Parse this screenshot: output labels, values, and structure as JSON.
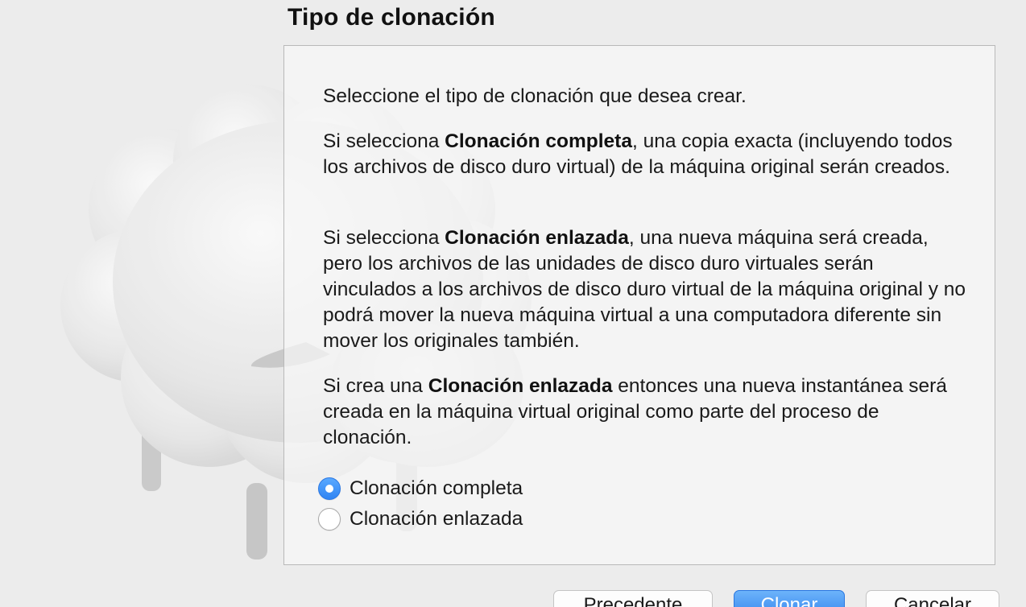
{
  "title": "Tipo de clonación",
  "intro": "Seleccione el tipo de clonación que desea crear.",
  "full_clone_para": {
    "prefix": "Si selecciona ",
    "bold": "Clonación completa",
    "suffix": ", una copia exacta (incluyendo todos los archivos de disco duro virtual) de la máquina original serán creados."
  },
  "linked_clone_para": {
    "prefix": "Si selecciona ",
    "bold": "Clonación enlazada",
    "suffix": ", una nueva máquina será creada, pero los archivos de las unidades de disco duro virtuales serán vinculados a los archivos de disco duro virtual de la máquina original y no podrá mover la nueva máquina virtual a una computadora diferente sin mover los originales también."
  },
  "snapshot_para": {
    "prefix": "Si crea una ",
    "bold": "Clonación enlazada",
    "suffix": " entonces una nueva instantánea será creada en la máquina virtual original como parte del proceso de clonación."
  },
  "options": [
    {
      "label": "Clonación completa",
      "selected": true
    },
    {
      "label": "Clonación enlazada",
      "selected": false
    }
  ],
  "buttons": {
    "previous": "Precedente",
    "clone": "Clonar",
    "cancel": "Cancelar"
  },
  "colors": {
    "accent": "#2f84f3",
    "background": "#ececec"
  },
  "icons": {
    "watermark": "sheep-illustration"
  }
}
